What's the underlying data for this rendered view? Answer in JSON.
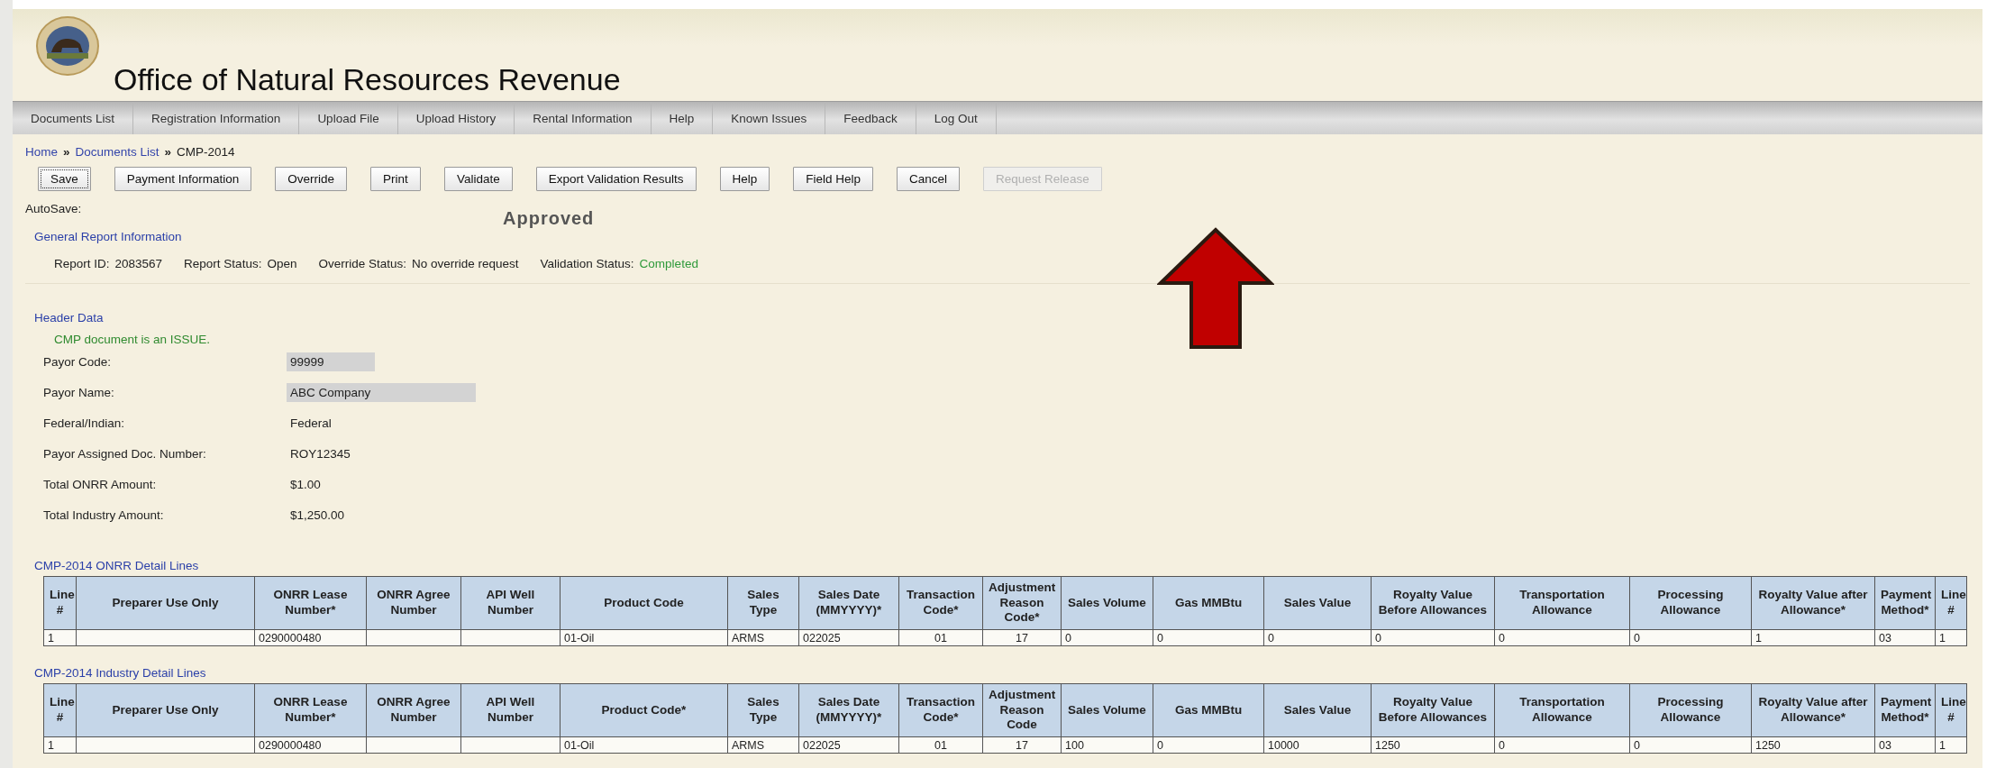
{
  "header": {
    "title": "Office of Natural Resources Revenue"
  },
  "nav": [
    "Documents List",
    "Registration Information",
    "Upload File",
    "Upload History",
    "Rental Information",
    "Help",
    "Known Issues",
    "Feedback",
    "Log Out"
  ],
  "breadcrumb": [
    {
      "label": "Home",
      "kind": "link"
    },
    {
      "label": "Documents List",
      "kind": "link"
    },
    {
      "label": "CMP-2014",
      "kind": "current"
    }
  ],
  "breadcrumb_separator": "»",
  "buttons": [
    {
      "label": "Save",
      "focused": true,
      "disabled": false
    },
    {
      "label": "Payment Information",
      "focused": false,
      "disabled": false
    },
    {
      "label": "Override",
      "focused": false,
      "disabled": false
    },
    {
      "label": "Print",
      "focused": false,
      "disabled": false
    },
    {
      "label": "Validate",
      "focused": false,
      "disabled": false
    },
    {
      "label": "Export Validation Results",
      "focused": false,
      "disabled": false
    },
    {
      "label": "Help",
      "focused": false,
      "disabled": false
    },
    {
      "label": "Field Help",
      "focused": false,
      "disabled": false
    },
    {
      "label": "Cancel",
      "focused": false,
      "disabled": false
    },
    {
      "label": "Request Release",
      "focused": false,
      "disabled": true
    }
  ],
  "autosave_label": "AutoSave:",
  "stamp": "Approved",
  "general_info": {
    "title": "General Report Information",
    "items": [
      {
        "label": "Report ID:",
        "value": "2083567",
        "kind": "plain"
      },
      {
        "label": "Report Status:",
        "value": "Open",
        "kind": "plain"
      },
      {
        "label": "Override Status:",
        "value": "No override request",
        "kind": "plain"
      },
      {
        "label": "Validation Status:",
        "value": "Completed",
        "kind": "success"
      }
    ]
  },
  "header_data": {
    "title": "Header Data",
    "message": "CMP document is an ISSUE.",
    "fields": [
      {
        "label": "Payor Code:",
        "value": "99999",
        "kind": "field"
      },
      {
        "label": "Payor Name:",
        "value": "ABC Company",
        "kind": "wide-field"
      },
      {
        "label": "Federal/Indian:",
        "value": "Federal",
        "kind": "text"
      },
      {
        "label": "Payor Assigned Doc. Number:",
        "value": "ROY12345",
        "kind": "text"
      },
      {
        "label": "Total ONRR Amount:",
        "value": "$1.00",
        "kind": "text"
      },
      {
        "label": "Total Industry Amount:",
        "value": "$1,250.00",
        "kind": "text"
      }
    ]
  },
  "tables": [
    {
      "title": "CMP-2014 ONRR Detail Lines",
      "columns": [
        "Line #",
        "Preparer Use Only",
        "ONRR Lease Number*",
        "ONRR Agree Number",
        "API Well Number",
        "Product Code",
        "Sales Type",
        "Sales Date (MMYYYY)*",
        "Transaction Code*",
        "Adjustment Reason Code*",
        "Sales Volume",
        "Gas MMBtu",
        "Sales Value",
        "Royalty Value Before Allowances",
        "Transportation Allowance",
        "Processing Allowance",
        "Royalty Value after Allowance*",
        "Payment Method*",
        "Line #"
      ],
      "rows": [
        [
          "1",
          "",
          "0290000480",
          "",
          "",
          "01-Oil",
          "ARMS",
          "022025",
          "01",
          "17",
          "0",
          "0",
          "0",
          "0",
          "0",
          "0",
          "1",
          "03",
          "1"
        ]
      ]
    },
    {
      "title": "CMP-2014 Industry Detail Lines",
      "columns": [
        "Line #",
        "Preparer Use Only",
        "ONRR Lease Number*",
        "ONRR Agree Number",
        "API Well Number",
        "Product Code*",
        "Sales Type",
        "Sales Date (MMYYYY)*",
        "Transaction Code*",
        "Adjustment Reason Code",
        "Sales Volume",
        "Gas MMBtu",
        "Sales Value",
        "Royalty Value Before Allowances",
        "Transportation Allowance",
        "Processing Allowance",
        "Royalty Value after Allowance*",
        "Payment Method*",
        "Line #"
      ],
      "rows": [
        [
          "1",
          "",
          "0290000480",
          "",
          "",
          "01-Oil",
          "ARMS",
          "022025",
          "01",
          "17",
          "100",
          "0",
          "10000",
          "1250",
          "0",
          "0",
          "1250",
          "03",
          "1"
        ]
      ]
    }
  ]
}
